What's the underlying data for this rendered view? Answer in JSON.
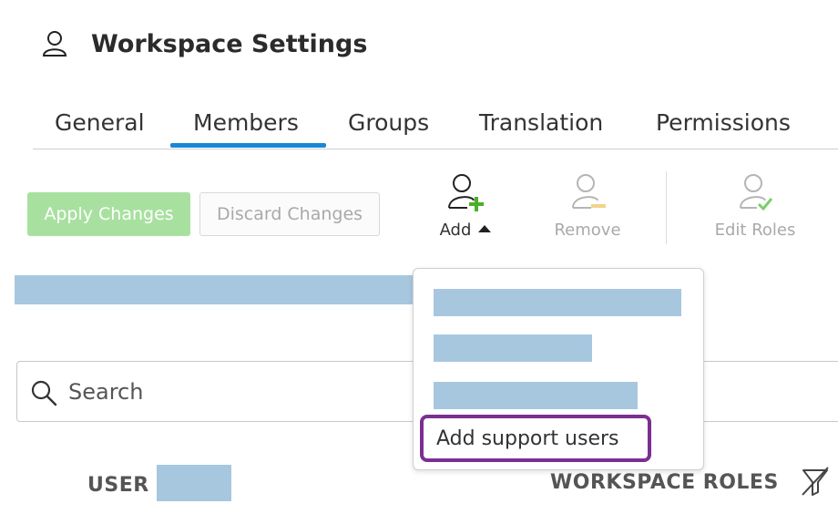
{
  "header": {
    "title": "Workspace Settings",
    "icon": "user-icon"
  },
  "tabs": [
    {
      "label": "General",
      "active": false
    },
    {
      "label": "Members",
      "active": true
    },
    {
      "label": "Groups",
      "active": false
    },
    {
      "label": "Translation",
      "active": false
    },
    {
      "label": "Permissions",
      "active": false
    }
  ],
  "toolbar": {
    "apply_label": "Apply Changes",
    "discard_label": "Discard Changes",
    "add_label": "Add",
    "remove_label": "Remove",
    "edit_roles_label": "Edit Roles"
  },
  "dropdown": {
    "items": [
      {
        "label": "",
        "redacted": true
      },
      {
        "label": "",
        "redacted": true
      },
      {
        "label": "",
        "redacted": true
      },
      {
        "label": "Add support users",
        "highlighted": true
      }
    ]
  },
  "search": {
    "placeholder": "Search",
    "value": ""
  },
  "table": {
    "columns": [
      "USER",
      "WORKSPACE ROLES"
    ]
  },
  "colors": {
    "accent": "#1a86d6",
    "apply_button": "#a8e0a0",
    "add_plus": "#4caf2a",
    "remove_minus": "#f0d58a",
    "edit_check": "#7ccf6a",
    "highlight_border": "#7b2f91",
    "redaction": "#a7c7df"
  }
}
